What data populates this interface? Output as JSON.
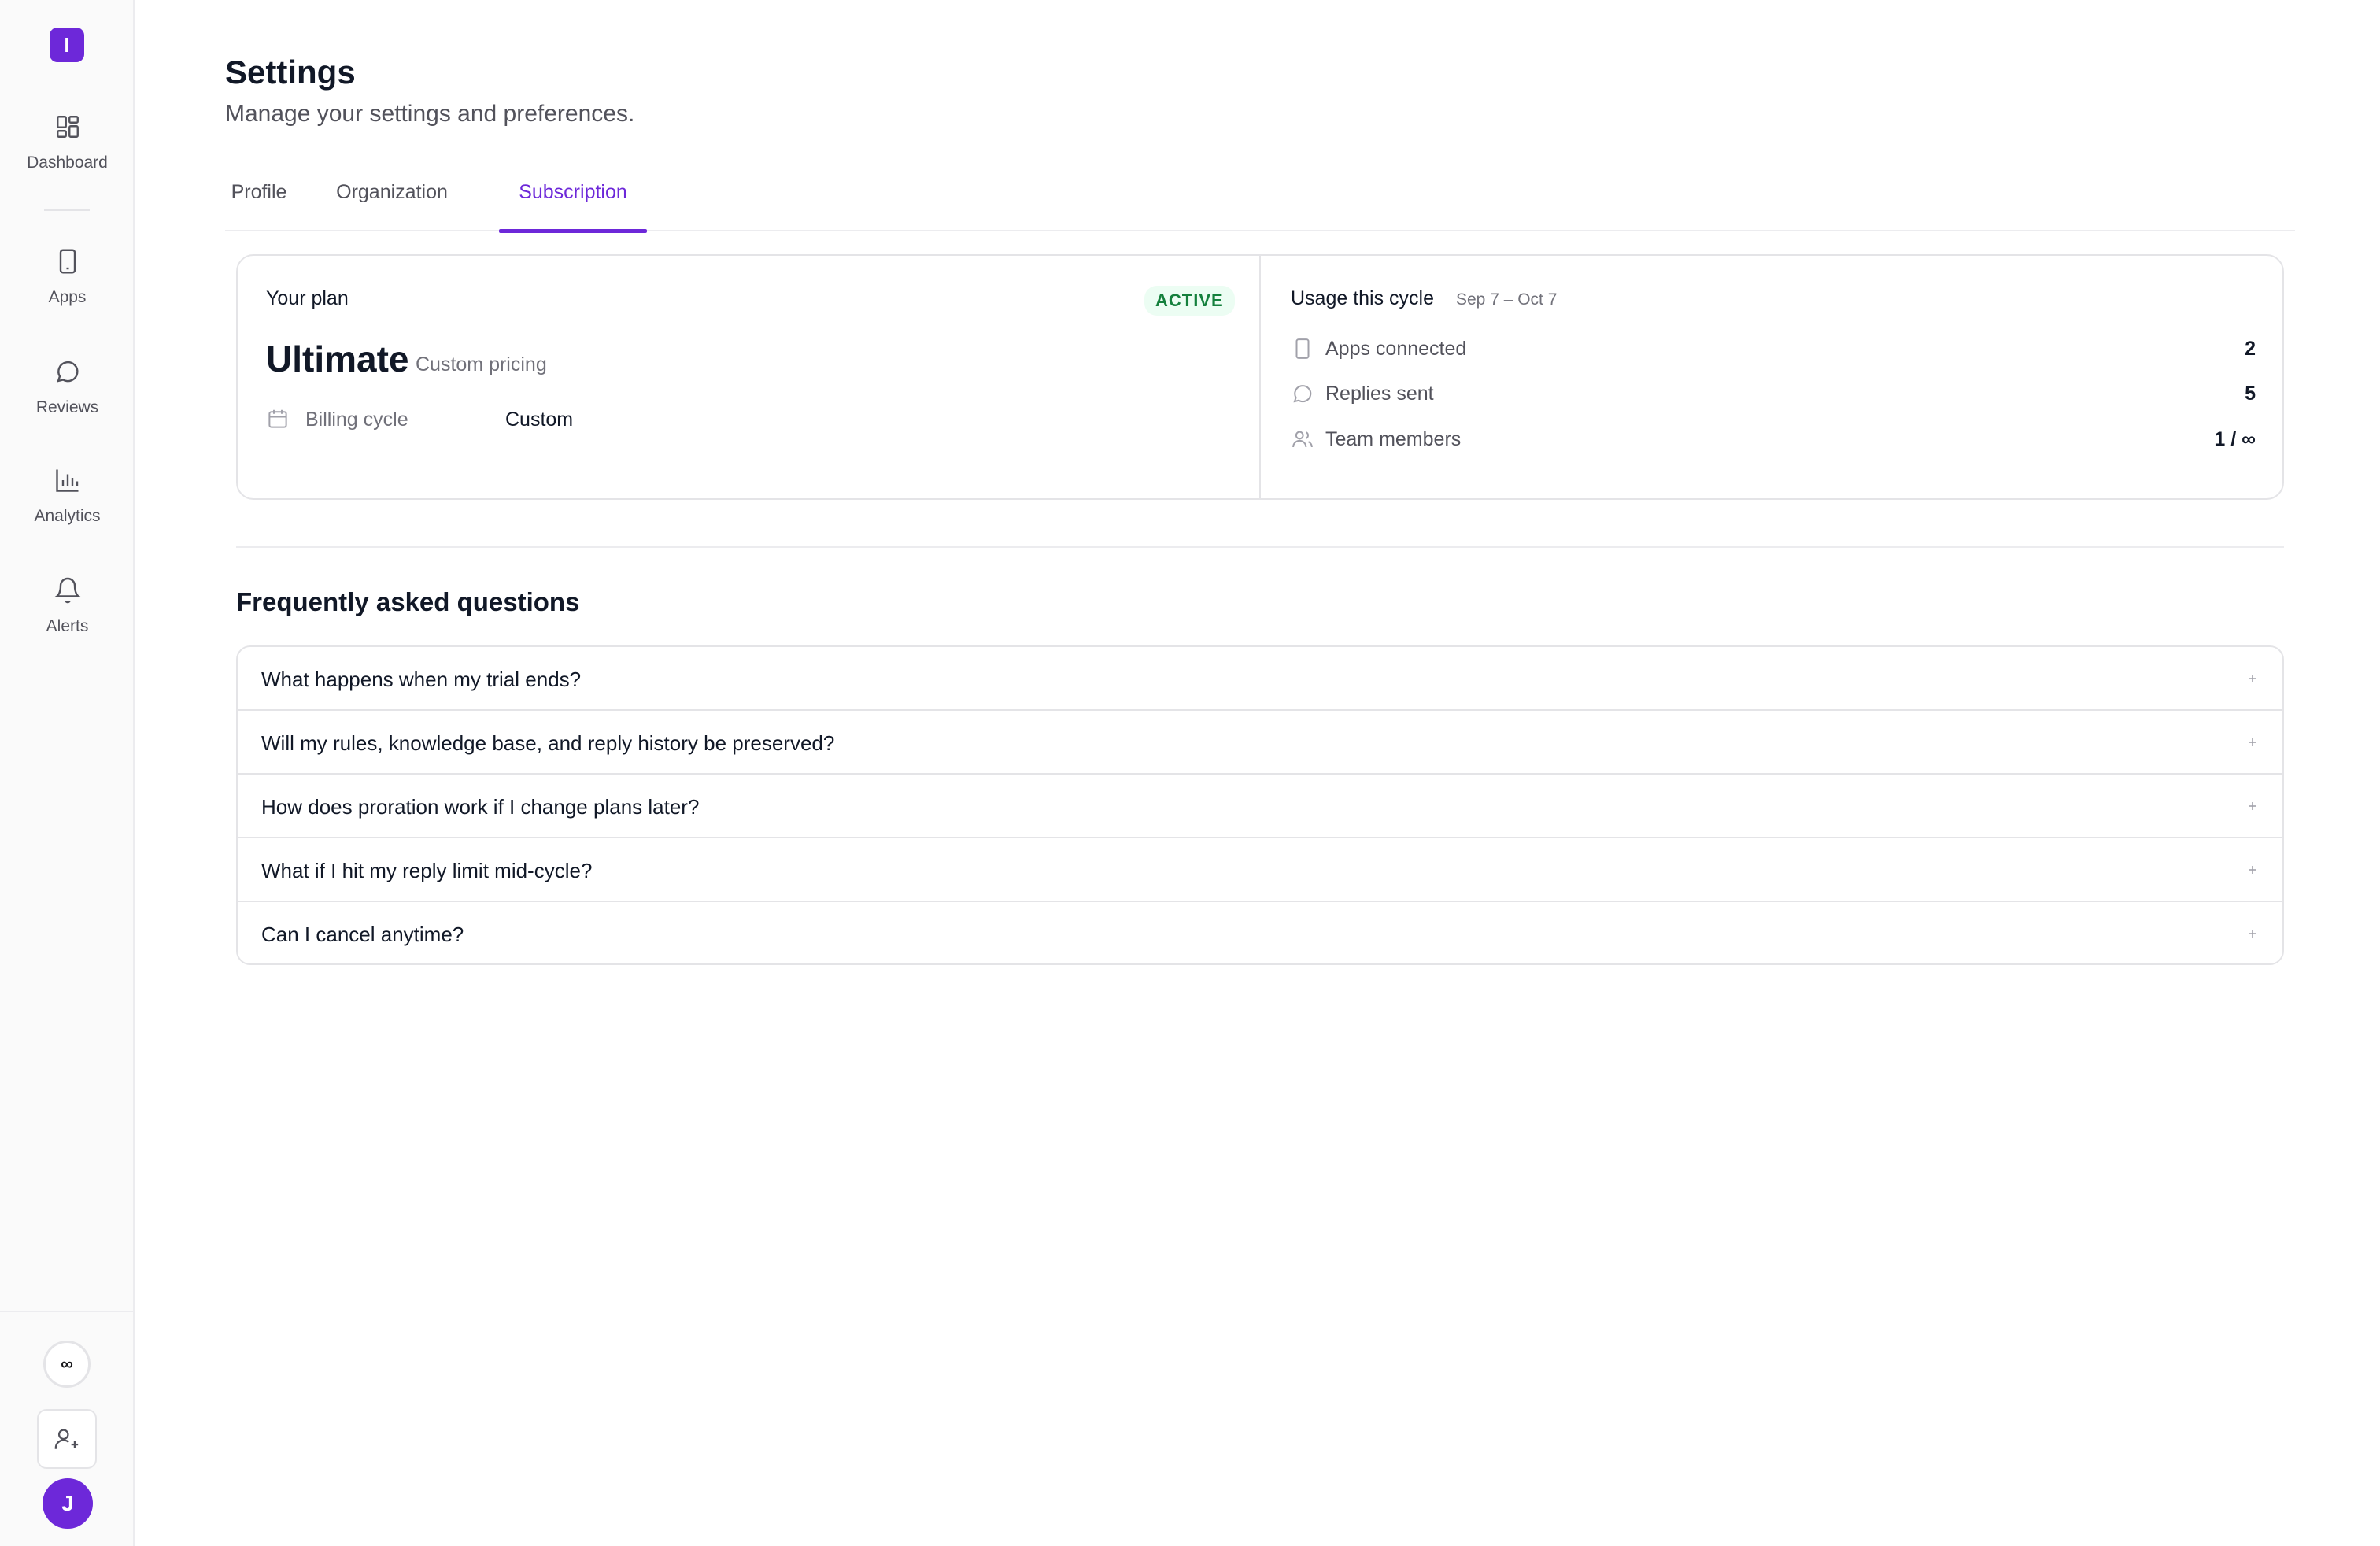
{
  "app": {
    "logo_letter": "I",
    "accent_color": "#6d28d9"
  },
  "sidebar": {
    "items": [
      {
        "label": "Dashboard",
        "icon": "dashboard-icon"
      },
      {
        "label": "Apps",
        "icon": "phone-icon"
      },
      {
        "label": "Reviews",
        "icon": "message-icon"
      },
      {
        "label": "Analytics",
        "icon": "bar-chart-icon"
      },
      {
        "label": "Alerts",
        "icon": "bell-icon"
      }
    ],
    "usage_symbol": "∞",
    "invite_icon": "user-plus-icon",
    "avatar_initial": "J"
  },
  "header": {
    "title": "Settings",
    "subtitle": "Manage your settings and preferences."
  },
  "tabs": [
    {
      "label": "Profile",
      "active": false
    },
    {
      "label": "Organization",
      "active": false
    },
    {
      "label": "Subscription",
      "active": true
    }
  ],
  "plan": {
    "label": "Your plan",
    "status": "ACTIVE",
    "status_color": "#15803d",
    "name": "Ultimate",
    "pricing": "Custom pricing",
    "billing_label": "Billing cycle",
    "billing_value": "Custom"
  },
  "usage": {
    "title": "Usage this cycle",
    "range": "Sep 7 – Oct 7",
    "rows": [
      {
        "label": "Apps connected",
        "value": "2",
        "icon": "phone-icon"
      },
      {
        "label": "Replies sent",
        "value": "5",
        "icon": "message-icon"
      },
      {
        "label": "Team members",
        "value": "1 / ∞",
        "icon": "users-icon"
      }
    ]
  },
  "faq": {
    "title": "Frequently asked questions",
    "items": [
      "What happens when my trial ends?",
      "Will my rules, knowledge base, and reply history be preserved?",
      "How does proration work if I change plans later?",
      "What if I hit my reply limit mid-cycle?",
      "Can I cancel anytime?"
    ]
  }
}
